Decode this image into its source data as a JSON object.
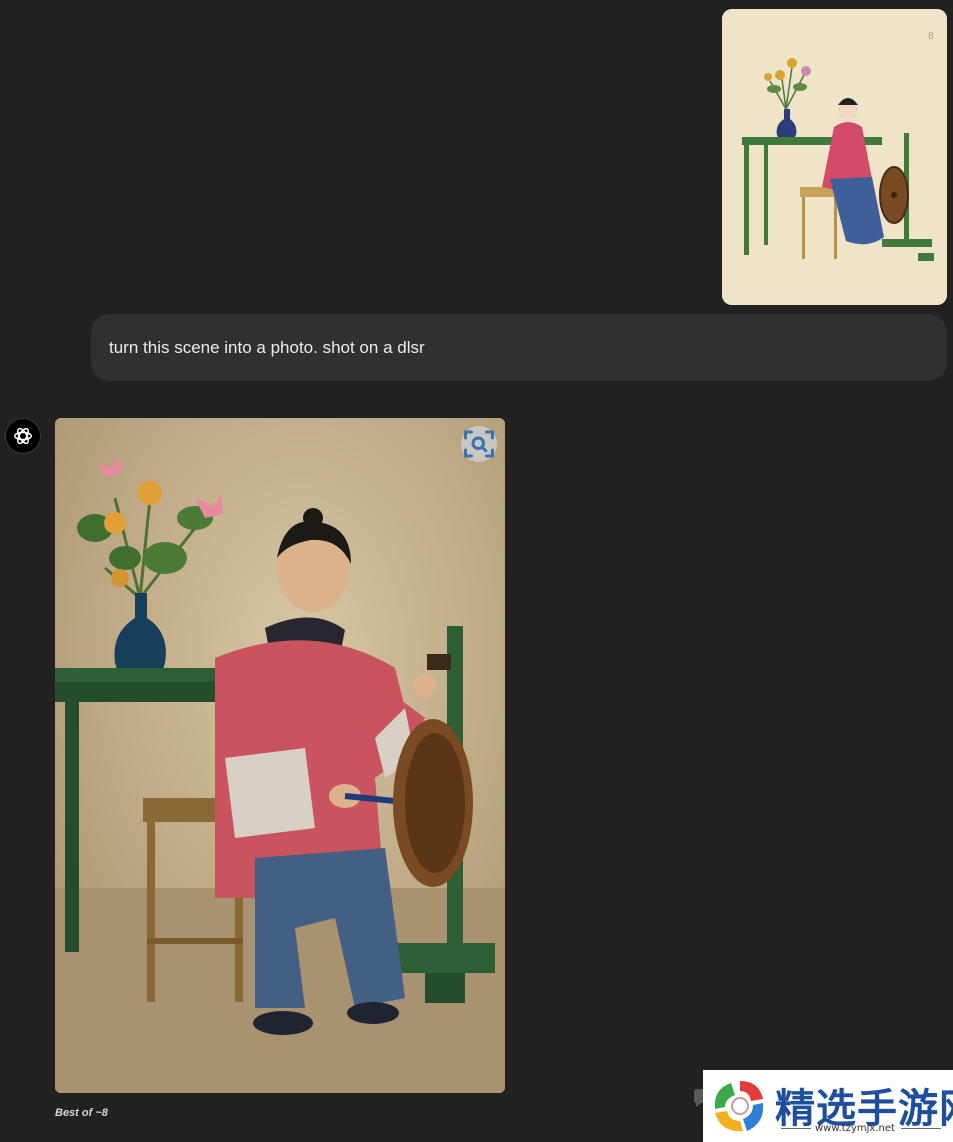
{
  "conversation": {
    "user_message": "turn this scene into a photo. shot on a dlsr",
    "assistant": {
      "caption": "Best of ~8"
    }
  },
  "attachment": {
    "page_number": "8"
  },
  "watermark": {
    "title": "精选手游网",
    "url": "www.tzymjx.net"
  },
  "icons": {
    "avatar": "openai-logo-icon",
    "image_action": "visual-search-icon",
    "message_action": "speech-bubble-icon"
  },
  "colors": {
    "background": "#212121",
    "bubble": "#303030",
    "text": "#ececec"
  }
}
